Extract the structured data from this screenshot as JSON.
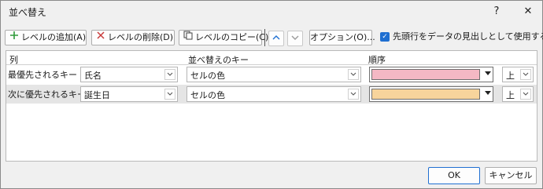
{
  "window": {
    "title": "並べ替え",
    "help_label": "?",
    "close_label": "✕"
  },
  "toolbar": {
    "add_level": "レベルの追加(A)",
    "delete_level": "レベルの削除(D)",
    "copy_level": "レベルのコピー(C)",
    "options": "オプション(O)...",
    "header_checkbox_label": "先頭行をデータの見出しとして使用する(H)",
    "header_checkbox_checked": true
  },
  "grid": {
    "headers": {
      "column": "列",
      "sort_on": "並べ替えのキー",
      "order": "順序"
    },
    "rows": [
      {
        "label": "最優先されるキー",
        "column": "氏名",
        "sort_on": "セルの色",
        "color": "#f4b8c4",
        "position": "上",
        "selected": false
      },
      {
        "label": "次に優先されるキー",
        "column": "誕生日",
        "sort_on": "セルの色",
        "color": "#f7d49c",
        "position": "上",
        "selected": true
      }
    ]
  },
  "footer": {
    "ok": "OK",
    "cancel": "キャンセル"
  },
  "colors": {
    "accent": "#1f6fd1",
    "add_icon": "#2e9a3a",
    "delete_icon": "#c83a3a"
  }
}
